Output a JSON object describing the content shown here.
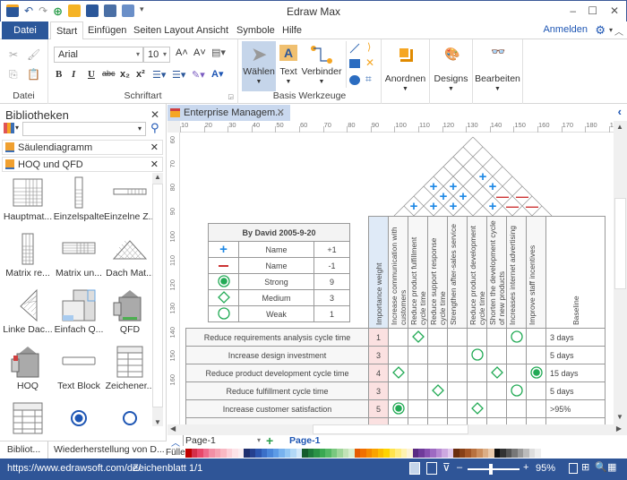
{
  "app": {
    "title": "Edraw Max",
    "window_controls": [
      "minimize-icon",
      "maximize-icon",
      "close-icon"
    ]
  },
  "quick_access": [
    "app-logo-icon",
    "undo-icon",
    "redo-icon",
    "new-icon",
    "open-icon",
    "save-icon",
    "print-icon",
    "export-icon",
    "customize-icon"
  ],
  "menu": {
    "file": "Datei",
    "tabs": [
      "Start",
      "Einfügen",
      "Seiten Layout",
      "Ansicht",
      "Symbole",
      "Hilfe"
    ],
    "active_tab": "Start",
    "sign_in": "Anmelden"
  },
  "ribbon": {
    "groups": {
      "file": "Datei",
      "font": "Schriftart",
      "basic_tools": "Basis Werkzeuge"
    },
    "font_name": "Arial",
    "font_size": "10",
    "format_buttons": [
      "B",
      "I",
      "U",
      "abc",
      "x₂",
      "x²"
    ],
    "tools": {
      "select": "Wählen",
      "text": "Text",
      "connector": "Verbinder"
    },
    "arrange": "Anordnen",
    "designs": "Designs",
    "edit": "Bearbeiten"
  },
  "libraries": {
    "title": "Bibliotheken",
    "search_value": "",
    "sections": [
      "Säulendiagramm",
      "HOQ und QFD"
    ],
    "shapes": [
      "Hauptmat...",
      "Einzelspalte",
      "Einzelne Z...",
      "Matrix re...",
      "Matrix un...",
      "Dach Mat...",
      "Linke Dac...",
      "Einfach Q...",
      "QFD",
      "HOQ",
      "Text Block",
      "Zeichener...",
      "",
      "",
      ""
    ],
    "bottom_tabs": [
      "Bibliot...",
      "Wiederherstellung von D..."
    ]
  },
  "document": {
    "tab_title": "Enterprise Managem...",
    "hruler": [
      "10",
      "20",
      "30",
      "40",
      "50",
      "60",
      "70",
      "80",
      "90",
      "100",
      "110",
      "120",
      "130",
      "140",
      "150",
      "160",
      "170",
      "180",
      "190"
    ],
    "vruler": [
      "60",
      "70",
      "80",
      "90",
      "100",
      "110",
      "120",
      "130",
      "140",
      "150",
      "160"
    ]
  },
  "legend": {
    "title": "By David 2005-9-20",
    "rows": [
      {
        "symbol": "plus",
        "name": "Name",
        "value": "+1"
      },
      {
        "symbol": "minus",
        "name": "Name",
        "value": "-1"
      },
      {
        "symbol": "strong",
        "name": "Strong",
        "value": "9"
      },
      {
        "symbol": "medium",
        "name": "Medium",
        "value": "3"
      },
      {
        "symbol": "weak",
        "name": "Weak",
        "value": "1"
      }
    ]
  },
  "hoq": {
    "importance_header": "Importance weight",
    "columns": [
      "Increase communication with customers",
      "Reduce product fulfillment cycle time",
      "Reduce support response cycle time",
      "Strengthen after-sales service",
      "Reduce product development cycle time",
      "Shorten the development cycle of new products",
      "Increases internet advertising",
      "Improve staff incentives"
    ],
    "baseline_header": "Baseline",
    "rows": [
      {
        "req": "Reduce requirements analysis cycle time",
        "weight": "1",
        "cells": [
          "",
          "medium",
          "",
          "",
          "",
          "",
          "weak",
          ""
        ],
        "baseline": "3 days"
      },
      {
        "req": "Increase design investment",
        "weight": "3",
        "cells": [
          "",
          "",
          "",
          "",
          "weak",
          "",
          "",
          ""
        ],
        "baseline": "5 days"
      },
      {
        "req": "Reduce product development cycle time",
        "weight": "4",
        "cells": [
          "medium",
          "",
          "",
          "",
          "",
          "medium",
          "",
          "strong"
        ],
        "baseline": "15 days"
      },
      {
        "req": "Reduce fulfillment cycle time",
        "weight": "3",
        "cells": [
          "",
          "",
          "medium",
          "",
          "",
          "",
          "weak",
          ""
        ],
        "baseline": "5 days"
      },
      {
        "req": "Increase customer satisfaction",
        "weight": "5",
        "cells": [
          "strong",
          "",
          "",
          "",
          "medium",
          "",
          "",
          ""
        ],
        "baseline": ">95%"
      }
    ]
  },
  "pages": {
    "current": "Page-1",
    "tabs": [
      "Page-1"
    ],
    "fill_label": "Füller"
  },
  "status": {
    "url": "https://www.edrawsoft.com/de/",
    "sheet": "Zeichenblatt 1/1",
    "zoom": "95%",
    "zoom_fraction": 0.45
  },
  "colors": {
    "accent": "#2b579a",
    "status_bar": "#2f5597",
    "green": "#22aa55",
    "blue_plus": "#1e88e5",
    "red_minus": "#cc3333",
    "weight_bg": "#fbe1e1"
  }
}
